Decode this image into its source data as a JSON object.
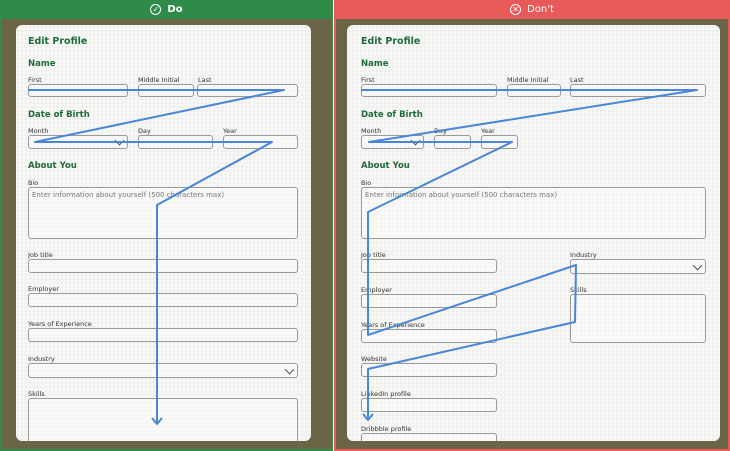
{
  "left_panel": {
    "header": {
      "label": "Do",
      "icon": "check-circle-icon"
    },
    "form_title": "Edit Profile",
    "sections": {
      "name": "Name",
      "dob": "Date of Birth",
      "about": "About You"
    },
    "labels": {
      "first": "First",
      "middle": "Middle Initial",
      "last": "Last",
      "month": "Month",
      "day": "Day",
      "year": "Year",
      "bio": "Bio",
      "job_title": "Job title",
      "employer": "Employer",
      "years_experience": "Years of Experience",
      "industry": "Industry",
      "skills": "Skills"
    },
    "bio_placeholder": "Enter information about yourself (500 characters max)"
  },
  "right_panel": {
    "header": {
      "label": "Don't",
      "icon": "x-circle-icon"
    },
    "form_title": "Edit Profile",
    "sections": {
      "name": "Name",
      "dob": "Date of Birth",
      "about": "About You"
    },
    "labels": {
      "first": "First",
      "middle": "Middle Initial",
      "last": "Last",
      "month": "Month",
      "day": "Day",
      "year": "Year",
      "bio": "Bio",
      "job_title": "Job title",
      "industry": "Industry",
      "employer": "Employer",
      "skills": "Skills",
      "years_experience": "Years of Experience",
      "website": "Website",
      "linkedin": "LinkedIn profile",
      "dribbble": "Dribbble profile"
    },
    "bio_placeholder": "Enter information about yourself (500 characters max)"
  },
  "colors": {
    "do": "#2e8b4a",
    "dont": "#e85a5a",
    "flow_line": "#4a86d8",
    "heading": "#1f6b3a"
  }
}
